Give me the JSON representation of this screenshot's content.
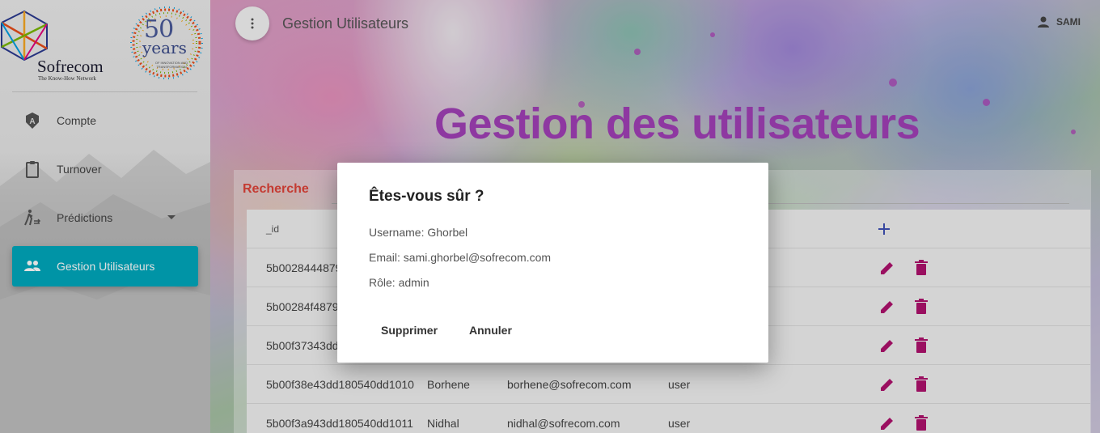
{
  "brand": {
    "name": "Sofrecom",
    "tagline": "The Know-How Network",
    "badge_number": "50",
    "badge_word": "years",
    "badge_tagline": "OF INNOVATION AND TRANSFORMATION"
  },
  "sidebar": {
    "items": [
      {
        "label": "Compte",
        "icon": "account-badge-icon",
        "active": false
      },
      {
        "label": "Turnover",
        "icon": "clipboard-icon",
        "active": false
      },
      {
        "label": "Prédictions",
        "icon": "walking-person-icon",
        "active": false,
        "has_dropdown": true
      },
      {
        "label": "Gestion Utilisateurs",
        "icon": "people-icon",
        "active": true
      }
    ]
  },
  "header": {
    "title": "Gestion Utilisateurs",
    "user_name": "SAMI"
  },
  "main": {
    "heading": "Gestion des utilisateurs",
    "search_label": "Recherche"
  },
  "table": {
    "columns": [
      "_id",
      "",
      "",
      "",
      ""
    ],
    "rows": [
      {
        "id": "5b0028444879",
        "username": "",
        "email": "",
        "role": ""
      },
      {
        "id": "5b00284f4879",
        "username": "",
        "email": "",
        "role": ""
      },
      {
        "id": "5b00f37343dd",
        "username": "",
        "email": "",
        "role": ""
      },
      {
        "id": "5b00f38e43dd180540dd1010",
        "username": "Borhene",
        "email": "borhene@sofrecom.com",
        "role": "user"
      },
      {
        "id": "5b00f3a943dd180540dd1011",
        "username": "Nidhal",
        "email": "nidhal@sofrecom.com",
        "role": "user"
      }
    ]
  },
  "dialog": {
    "title": "Êtes-vous sûr ?",
    "username_line": "Username: Ghorbel",
    "email_line": "Email: sami.ghorbel@sofrecom.com",
    "role_line": "Rôle: admin",
    "confirm_label": "Supprimer",
    "cancel_label": "Annuler"
  },
  "colors": {
    "accent": "#00a9be",
    "heading": "#a240b8",
    "action_icons": "#b0126e",
    "search_label": "#e0443a",
    "add_icon": "#3f51b5"
  }
}
